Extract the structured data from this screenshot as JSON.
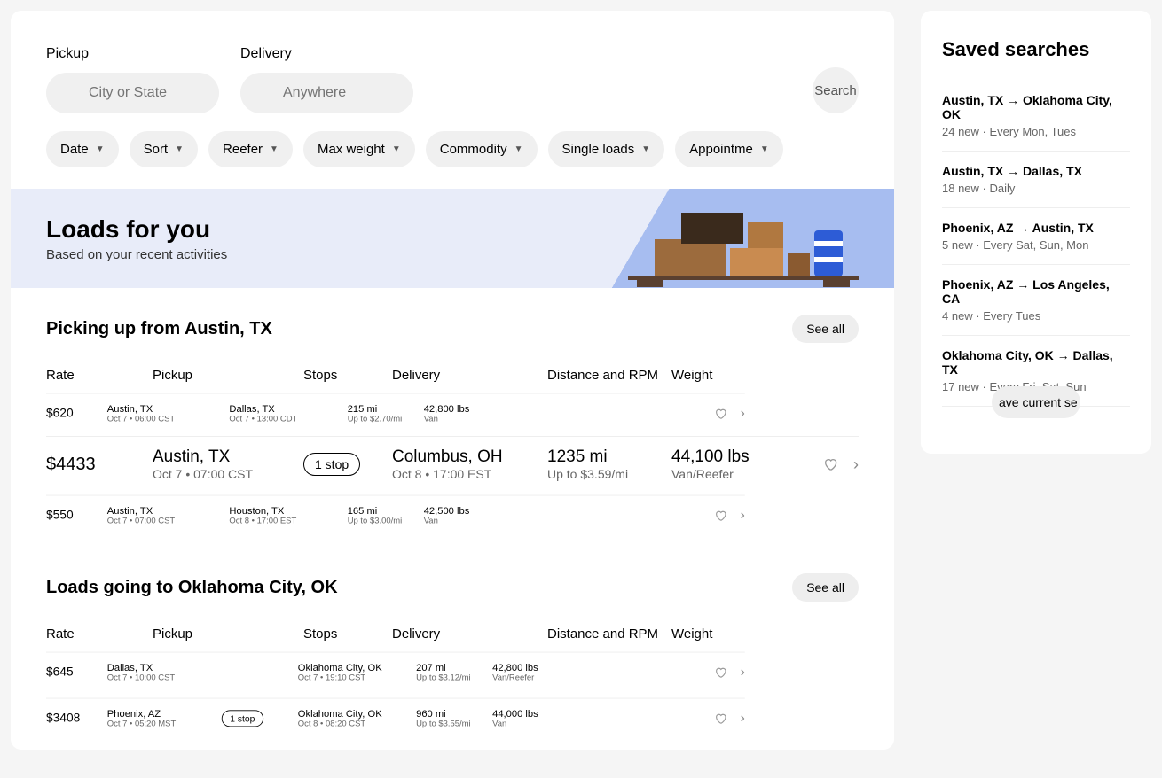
{
  "search": {
    "pickup_label": "Pickup",
    "pickup_placeholder": "City or State",
    "delivery_label": "Delivery",
    "delivery_placeholder": "Anywhere",
    "search_btn": "Search"
  },
  "filters": [
    "Date",
    "Sort",
    "Reefer",
    "Max weight",
    "Commodity",
    "Single loads",
    "Appointme"
  ],
  "hero": {
    "title": "Loads for you",
    "subtitle": "Based on your recent activities"
  },
  "columns": {
    "rate": "Rate",
    "pickup": "Pickup",
    "stops": "Stops",
    "delivery": "Delivery",
    "distance": "Distance and RPM",
    "weight": "Weight"
  },
  "see_all": "See all",
  "section1": {
    "title": "Picking up from Austin, TX",
    "rows": [
      {
        "size": "small",
        "rate": "$620",
        "p_city": "Austin, TX",
        "p_time": "Oct 7 • 06:00 CST",
        "stops": "",
        "d_city": "Dallas, TX",
        "d_time": "Oct 7 • 13:00 CDT",
        "dist": "215 mi",
        "rpm": "Up to $2.70/mi",
        "wt": "42,800 lbs",
        "eq": "Van"
      },
      {
        "size": "big",
        "rate": "$4433",
        "p_city": "Austin, TX",
        "p_time": "Oct 7 • 07:00 CST",
        "stops": "1 stop",
        "d_city": "Columbus, OH",
        "d_time": "Oct 8 • 17:00 EST",
        "dist": "1235 mi",
        "rpm": "Up to $3.59/mi",
        "wt": "44,100 lbs",
        "eq": "Van/Reefer"
      },
      {
        "size": "small",
        "rate": "$550",
        "p_city": "Austin, TX",
        "p_time": "Oct 7 • 07:00 CST",
        "stops": "",
        "d_city": "Houston, TX",
        "d_time": "Oct 8 • 17:00 EST",
        "dist": "165 mi",
        "rpm": "Up to $3.00/mi",
        "wt": "42,500 lbs",
        "eq": "Van"
      }
    ]
  },
  "section2": {
    "title": "Loads going to Oklahoma City, OK",
    "rows": [
      {
        "size": "med",
        "rate": "$645",
        "p_city": "Dallas, TX",
        "p_time": "Oct 7 • 10:00 CST",
        "stops": "",
        "d_city": "Oklahoma City, OK",
        "d_time": "Oct 7 • 19:10 CST",
        "dist": "207 mi",
        "rpm": "Up to $3.12/mi",
        "wt": "42,800 lbs",
        "eq": "Van/Reefer"
      },
      {
        "size": "med",
        "rate": "$3408",
        "p_city": "Phoenix, AZ",
        "p_time": "Oct 7 • 05:20 MST",
        "stops": "1 stop",
        "d_city": "Oklahoma City, OK",
        "d_time": "Oct 8 • 08:20 CST",
        "dist": "960 mi",
        "rpm": "Up to $3.55/mi",
        "wt": "44,000 lbs",
        "eq": "Van"
      }
    ]
  },
  "saved": {
    "title": "Saved searches",
    "items": [
      {
        "route": "Austin, TX → Oklahoma City, OK",
        "meta": "24 new · Every Mon, Tues"
      },
      {
        "route": "Austin, TX → Dallas, TX",
        "meta": "18 new · Daily"
      },
      {
        "route": "Phoenix, AZ → Austin, TX",
        "meta": "5 new · Every Sat, Sun, Mon"
      },
      {
        "route": "Phoenix, AZ → Los Angeles, CA",
        "meta": "4 new · Every Tues"
      },
      {
        "route": "Oklahoma City, OK → Dallas, TX",
        "meta": "17 new · Every Fri, Sat, Sun"
      }
    ],
    "save_btn": "ave current se"
  }
}
